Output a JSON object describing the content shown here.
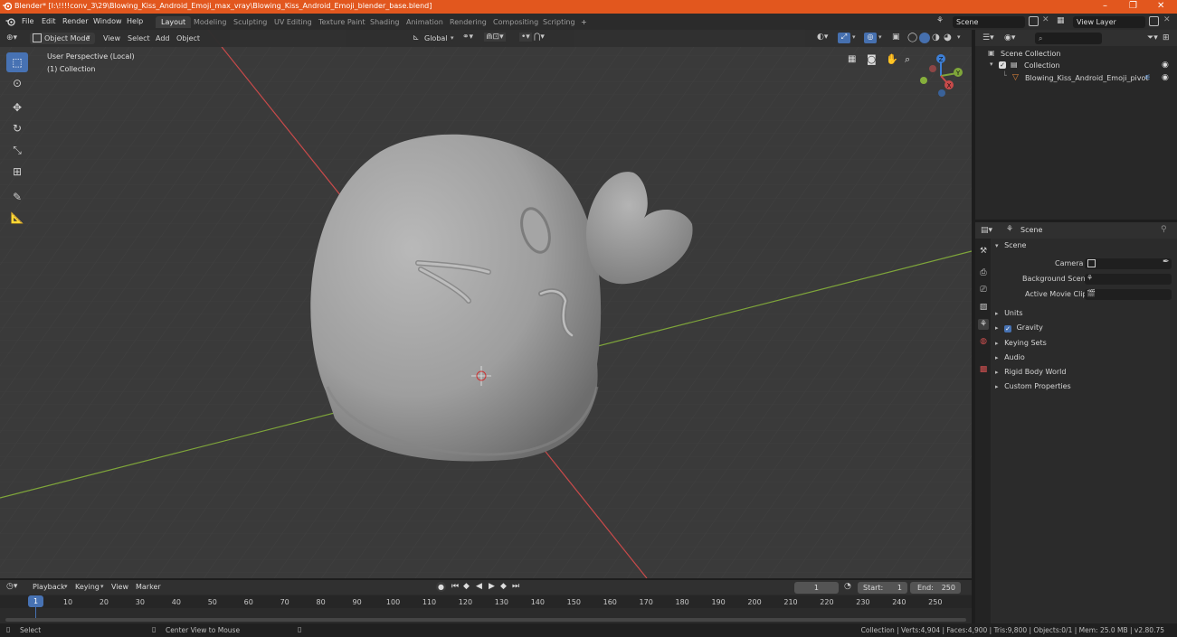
{
  "window": {
    "title": "Blender* [I:\\!!!!conv_3\\29\\Blowing_Kiss_Android_Emoji_max_vray\\Blowing_Kiss_Android_Emoji_blender_base.blend]",
    "minimize": "–",
    "restore": "❐",
    "close": "✕"
  },
  "menu": {
    "items": [
      "File",
      "Edit",
      "Render",
      "Window",
      "Help"
    ],
    "workspaces": [
      "Layout",
      "Modeling",
      "Sculpting",
      "UV Editing",
      "Texture Paint",
      "Shading",
      "Animation",
      "Rendering",
      "Compositing",
      "Scripting"
    ],
    "active_workspace": "Layout",
    "add_tab": "+",
    "scene_name": "Scene",
    "view_layer": "View Layer"
  },
  "viewport_header": {
    "mode": "Object Mode",
    "menus": [
      "View",
      "Select",
      "Add",
      "Object"
    ],
    "transform_orientation": "Global"
  },
  "viewport": {
    "perspective_label": "User Perspective (Local)",
    "collection_label": "(1) Collection",
    "gizmo_axes": [
      "Z",
      "Y",
      "X"
    ]
  },
  "outliner": {
    "search_placeholder": "",
    "rows": [
      {
        "label": "Scene Collection"
      },
      {
        "label": "Collection"
      },
      {
        "label": "Blowing_Kiss_Android_Emoji_pivot"
      }
    ]
  },
  "properties": {
    "context": "Scene",
    "panel_title": "Scene",
    "fields": [
      {
        "label": "Camera"
      },
      {
        "label": "Background Scene"
      },
      {
        "label": "Active Movie Clip"
      }
    ],
    "subpanels": [
      "Units",
      "Gravity",
      "Keying Sets",
      "Audio",
      "Rigid Body World",
      "Custom Properties"
    ],
    "gravity_checked": true
  },
  "timeline": {
    "menus": [
      "Playback",
      "Keying",
      "View",
      "Marker"
    ],
    "current_frame": "1",
    "start_label": "Start:",
    "start": "1",
    "end_label": "End:",
    "end": "250",
    "ticks": [
      "10",
      "20",
      "30",
      "40",
      "50",
      "60",
      "70",
      "80",
      "90",
      "100",
      "110",
      "120",
      "130",
      "140",
      "150",
      "160",
      "170",
      "180",
      "190",
      "200",
      "210",
      "220",
      "230",
      "240",
      "250"
    ],
    "playhead": "1"
  },
  "statusbar": {
    "left_action": "Select",
    "middle_action": "Center View to Mouse",
    "stats": "Collection | Verts:4,904 | Faces:4,900 | Tris:9,800 | Objects:0/1 | Mem: 25.0 MB | v2.80.75"
  },
  "colors": {
    "titlebar": "#e2571e",
    "accent": "#4772b3",
    "x_axis": "#c84a4a",
    "y_axis": "#7fa63a",
    "z_axis": "#3d7fd6"
  }
}
